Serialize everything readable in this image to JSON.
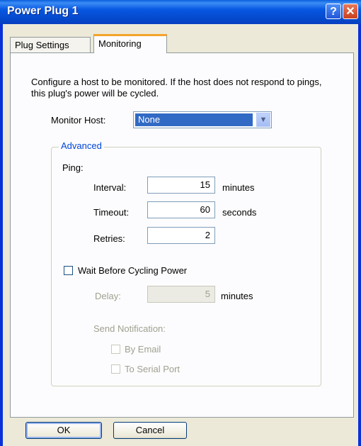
{
  "window": {
    "title": "Power Plug 1",
    "help_glyph": "?",
    "close_glyph": "✕"
  },
  "tabs": [
    {
      "label": "Plug Settings"
    },
    {
      "label": "Monitoring",
      "selected": true
    }
  ],
  "monitoring": {
    "description": "Configure a host to be monitored.  If the host does not respond to pings, this plug's power will be cycled.",
    "monitor_host_label": "Monitor Host:",
    "monitor_host_value": "None",
    "advanced_label": "Advanced",
    "ping_label": "Ping:",
    "interval": {
      "label": "Interval:",
      "value": "15",
      "unit": "minutes"
    },
    "timeout": {
      "label": "Timeout:",
      "value": "60",
      "unit": "seconds"
    },
    "retries": {
      "label": "Retries:",
      "value": "2"
    },
    "wait_before_cycling": {
      "label": "Wait Before Cycling Power",
      "checked": false
    },
    "delay": {
      "label": "Delay:",
      "value": "5",
      "unit": "minutes"
    },
    "send_notification_label": "Send Notification:",
    "by_email": {
      "label": "By Email",
      "checked": false
    },
    "to_serial_port": {
      "label": "To Serial Port",
      "checked": false
    }
  },
  "buttons": {
    "ok": "OK",
    "cancel": "Cancel"
  },
  "colors": {
    "titlebar": "#0757e1",
    "selected_highlight": "#316ac5",
    "group_legend": "#0046d5",
    "tab_accent": "#f3a32a"
  }
}
